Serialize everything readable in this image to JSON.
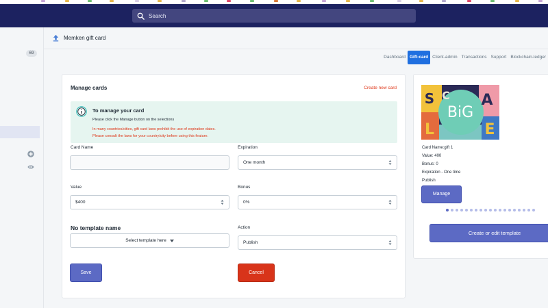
{
  "topbar": {
    "search_placeholder": "Search",
    "accent": "#1c2260"
  },
  "sidebar": {
    "badge_count": "69",
    "icons": [
      "plus-circle-icon",
      "eye-icon"
    ]
  },
  "header": {
    "title": "Memken gift card",
    "icon": "upload-icon"
  },
  "tabs": [
    {
      "label": "Dashboard",
      "active": false
    },
    {
      "label": "Gift-card",
      "active": true
    },
    {
      "label": "Client-admin",
      "active": false
    },
    {
      "label": "Transactions",
      "active": false
    },
    {
      "label": "Support",
      "active": false
    },
    {
      "label": "Blockchain-ledger",
      "active": false
    }
  ],
  "manage": {
    "title": "Manage cards",
    "create_link": "Create new card",
    "info": {
      "title": "To manage your card",
      "subtitle": "Please click the Manage button on the selections",
      "warning_1": "In many countries/cities, gift card laws prohibit the use of expiration dates.",
      "warning_2": "Please consult the laws for your country/city before using this feature."
    },
    "fields": {
      "card_name_label": "Card Name",
      "card_name_value": "",
      "expiration_label": "Expiration",
      "expiration_value": "One month",
      "value_label": "Value",
      "value_value": "$400",
      "bonus_label": "Bonus",
      "bonus_value": "0%",
      "template_title": "No template name",
      "template_select": "Select template here",
      "action_label": "Action",
      "action_value": "Publish"
    },
    "save_label": "Save",
    "cancel_label": "Cancel"
  },
  "preview": {
    "image_letters": [
      "S",
      "C",
      "A",
      "L",
      "E",
      "BiG"
    ],
    "card_name": "Card Name:gift 1",
    "value": "Value: 400",
    "bonus": "Bonus: 0",
    "expiration": "Expiration - One time",
    "status": "Publish",
    "manage_label": "Manage",
    "edit_template_label": "Create or edit template",
    "carousel_dots": 19,
    "carousel_active": 0
  },
  "colors": {
    "primary": "#5c6ac4",
    "danger": "#d8341a",
    "link_red": "#de3618",
    "info_bg": "#e6f5f0",
    "tab_active": "#1f6fe0"
  }
}
